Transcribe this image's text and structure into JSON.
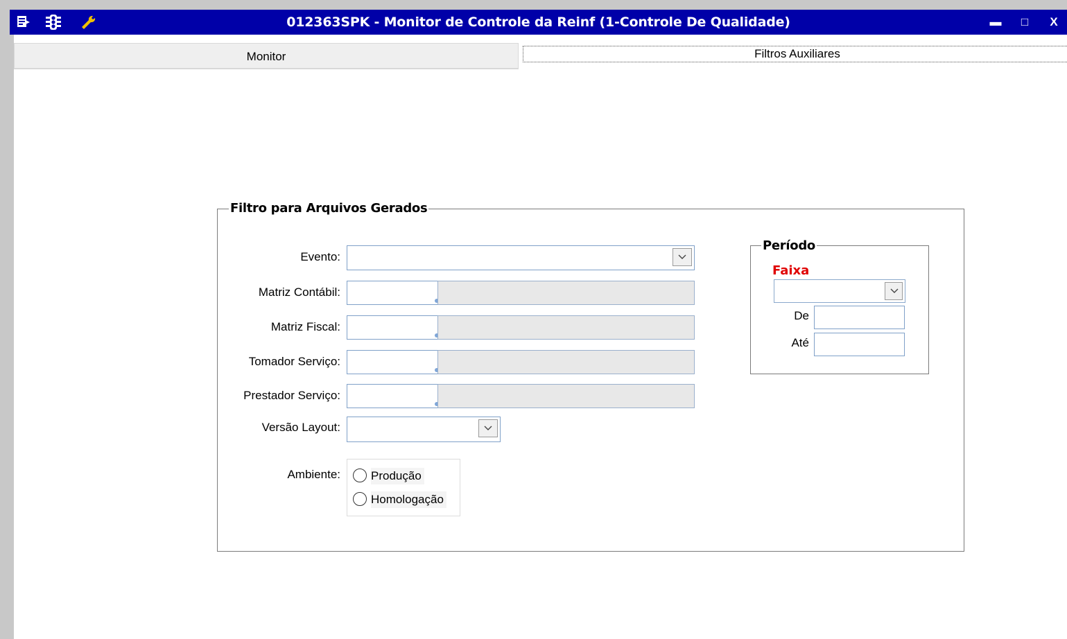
{
  "window": {
    "title": "012363SPK - Monitor de Controle da Reinf (1-Controle De Qualidade)",
    "icons": [
      "menu-icon",
      "traffic-light-icon",
      "wrench-icon"
    ],
    "controls": {
      "minimize": "▬",
      "maximize": "□",
      "close": "X"
    }
  },
  "tabs": [
    {
      "label": "Monitor",
      "active": false
    },
    {
      "label": "Filtros Auxiliares",
      "active": true
    }
  ],
  "filtro": {
    "legend": "Filtro para Arquivos Gerados",
    "evento": {
      "label": "Evento:",
      "value": ""
    },
    "matriz_contabil": {
      "label": "Matriz Contábil:",
      "code": "",
      "description": ""
    },
    "matriz_fiscal": {
      "label": "Matriz Fiscal:",
      "code": "",
      "description": ""
    },
    "tomador_servico": {
      "label": "Tomador Serviço:",
      "code": "",
      "description": ""
    },
    "prestador_servico": {
      "label": "Prestador Serviço:",
      "code": "",
      "description": ""
    },
    "versao_layout": {
      "label": "Versão Layout:",
      "value": ""
    },
    "ambiente": {
      "label": "Ambiente:",
      "options": [
        "Produção",
        "Homologação"
      ],
      "selected": null
    }
  },
  "periodo": {
    "legend": "Período",
    "faixa_label": "Faixa",
    "faixa_value": "",
    "de_label": "De",
    "de_value": "",
    "ate_label": "Até",
    "ate_value": ""
  },
  "colors": {
    "titlebar": "#0000a8",
    "faixa_label": "#e00000",
    "wrench_icon": "#f0c000"
  }
}
